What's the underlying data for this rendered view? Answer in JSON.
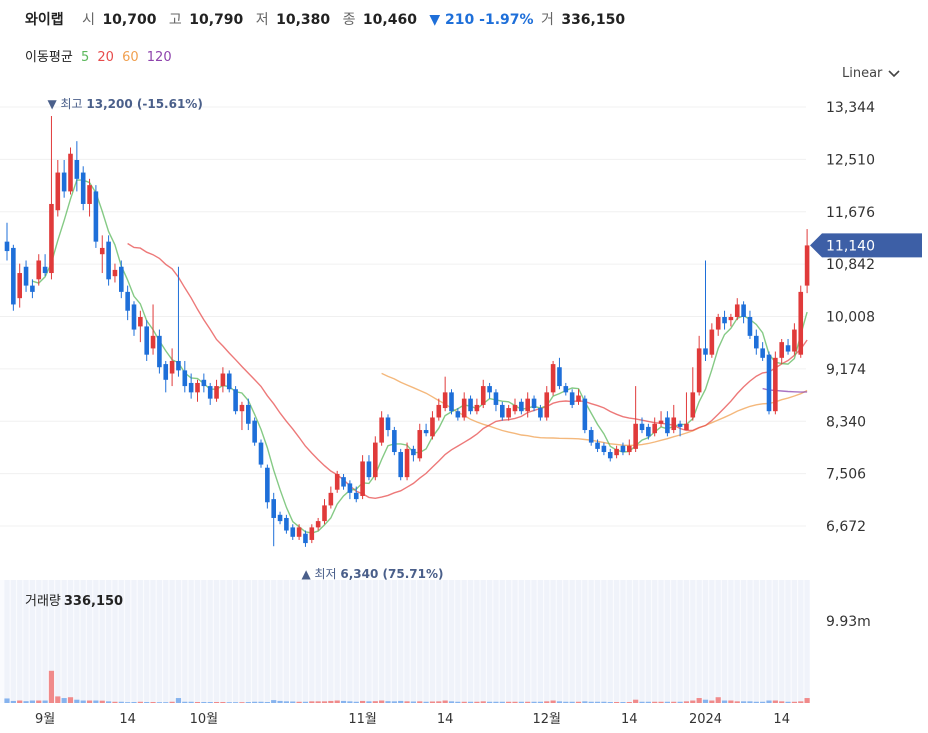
{
  "header": {
    "name": "와이랩",
    "open_label": "시",
    "open": "10,700",
    "high_label": "고",
    "high": "10,790",
    "low_label": "저",
    "low": "10,380",
    "close_label": "종",
    "close": "10,460",
    "change": "▼ 210 -1.97%",
    "volume_label": "거",
    "volume": "336,150"
  },
  "moving_average": {
    "label": "이동평균",
    "periods": [
      {
        "label": "5",
        "color": "#5cb85c"
      },
      {
        "label": "20",
        "color": "#e74c4c"
      },
      {
        "label": "60",
        "color": "#f0a050"
      },
      {
        "label": "120",
        "color": "#8e44ad"
      }
    ]
  },
  "scale_selector": {
    "value": "Linear",
    "icon": "chevron-down-icon"
  },
  "volume_panel": {
    "label": "거래량",
    "value": "336,150",
    "axis_label": "9.93m"
  },
  "colors": {
    "up": "#e03a3a",
    "down": "#1e6fd9",
    "current_price_tag": "#3d5fa6"
  },
  "chart_data": {
    "type": "candlestick",
    "y_ticks": [
      "13,344",
      "12,510",
      "11,676",
      "10,842",
      "10,008",
      "9,174",
      "8,340",
      "7,506",
      "6,672"
    ],
    "y_tick_values": [
      13344,
      12510,
      11676,
      10842,
      10008,
      9174,
      8340,
      7506,
      6672
    ],
    "x_ticks": [
      "9월",
      "14",
      "10월",
      "11월",
      "14",
      "12월",
      "14",
      "2024",
      "14"
    ],
    "x_tick_index": [
      6,
      19,
      31,
      56,
      69,
      85,
      98,
      110,
      122
    ],
    "current_price": "11,140",
    "current_price_value": 11140,
    "high_marker": {
      "arrow": "▼",
      "label": "최고",
      "value": "13,200 (-15.61%)",
      "index": 7,
      "price": 13200
    },
    "low_marker": {
      "arrow": "▲",
      "label": "최저",
      "value": "6,340 (75.71%)",
      "index": 47,
      "price": 6340
    },
    "candles": [
      [
        11200,
        11050,
        11500,
        10900
      ],
      [
        11100,
        10200,
        11150,
        10100
      ],
      [
        10300,
        10700,
        10850,
        10150
      ],
      [
        10800,
        10500,
        10900,
        10400
      ],
      [
        10500,
        10400,
        10600,
        10300
      ],
      [
        10600,
        10900,
        11000,
        10500
      ],
      [
        10800,
        10700,
        11000,
        10650
      ],
      [
        10700,
        11800,
        13200,
        10600
      ],
      [
        11700,
        12300,
        12500,
        11600
      ],
      [
        12300,
        12000,
        12500,
        11900
      ],
      [
        12000,
        12600,
        12700,
        11950
      ],
      [
        12500,
        12200,
        12800,
        12000
      ],
      [
        12300,
        11800,
        12400,
        11700
      ],
      [
        11800,
        12100,
        12200,
        11600
      ],
      [
        12000,
        11200,
        12100,
        11100
      ],
      [
        11000,
        11100,
        11300,
        10700
      ],
      [
        11200,
        10600,
        11300,
        10500
      ],
      [
        10650,
        10750,
        10850,
        10550
      ],
      [
        10800,
        10400,
        10900,
        10300
      ],
      [
        10400,
        10100,
        10500,
        9950
      ],
      [
        10200,
        9800,
        10250,
        9700
      ],
      [
        9850,
        10000,
        10100,
        9600
      ],
      [
        9850,
        9400,
        9950,
        9300
      ],
      [
        9500,
        9700,
        10200,
        9400
      ],
      [
        9700,
        9200,
        9800,
        9100
      ],
      [
        9250,
        9000,
        9300,
        8800
      ],
      [
        9100,
        9300,
        9500,
        8900
      ],
      [
        9300,
        9150,
        10800,
        9050
      ],
      [
        9150,
        8900,
        9300,
        8800
      ],
      [
        8950,
        8800,
        9100,
        8700
      ],
      [
        8800,
        8950,
        9000,
        8650
      ],
      [
        9000,
        8900,
        9100,
        8800
      ],
      [
        8900,
        8700,
        8950,
        8600
      ],
      [
        8700,
        8900,
        9000,
        8650
      ],
      [
        8900,
        9100,
        9200,
        8800
      ],
      [
        9100,
        8850,
        9150,
        8800
      ],
      [
        8850,
        8500,
        8900,
        8450
      ],
      [
        8500,
        8600,
        8650,
        8200
      ],
      [
        8600,
        8300,
        8700,
        8200
      ],
      [
        8350,
        8000,
        8400,
        7950
      ],
      [
        8000,
        7650,
        8050,
        7600
      ],
      [
        7600,
        7050,
        7650,
        6950
      ],
      [
        7100,
        6800,
        7200,
        6350
      ],
      [
        6850,
        6750,
        6900,
        6700
      ],
      [
        6800,
        6600,
        6850,
        6550
      ],
      [
        6650,
        6500,
        6700,
        6450
      ],
      [
        6500,
        6650,
        6700,
        6450
      ],
      [
        6550,
        6400,
        6600,
        6340
      ],
      [
        6450,
        6650,
        6700,
        6400
      ],
      [
        6650,
        6750,
        6800,
        6600
      ],
      [
        6750,
        7000,
        7100,
        6700
      ],
      [
        7000,
        7200,
        7300,
        6950
      ],
      [
        7250,
        7500,
        7550,
        7200
      ],
      [
        7450,
        7300,
        7500,
        7250
      ],
      [
        7350,
        7200,
        7400,
        7100
      ],
      [
        7200,
        7100,
        7300,
        7050
      ],
      [
        7150,
        7700,
        7800,
        7100
      ],
      [
        7700,
        7450,
        7800,
        7400
      ],
      [
        7450,
        8000,
        8100,
        7400
      ],
      [
        8000,
        8400,
        8500,
        7950
      ],
      [
        8400,
        8200,
        8450,
        8100
      ],
      [
        8200,
        7850,
        8250,
        7800
      ],
      [
        7850,
        7450,
        7900,
        7400
      ],
      [
        7450,
        7900,
        8000,
        7400
      ],
      [
        7900,
        7800,
        7950,
        7700
      ],
      [
        7750,
        8200,
        8300,
        7700
      ],
      [
        8200,
        8150,
        8300,
        8100
      ],
      [
        8100,
        8400,
        8500,
        8050
      ],
      [
        8400,
        8600,
        8700,
        8350
      ],
      [
        8550,
        8800,
        9050,
        8500
      ],
      [
        8800,
        8500,
        8850,
        8450
      ],
      [
        8500,
        8400,
        8550,
        8350
      ],
      [
        8400,
        8700,
        8800,
        8350
      ],
      [
        8700,
        8500,
        8750,
        8450
      ],
      [
        8500,
        8600,
        8700,
        8450
      ],
      [
        8600,
        8900,
        9000,
        8550
      ],
      [
        8900,
        8800,
        8950,
        8700
      ],
      [
        8800,
        8600,
        8850,
        8500
      ],
      [
        8600,
        8400,
        8650,
        8350
      ],
      [
        8400,
        8550,
        8600,
        8350
      ],
      [
        8500,
        8600,
        8700,
        8450
      ],
      [
        8650,
        8500,
        8700,
        8450
      ],
      [
        8500,
        8700,
        8800,
        8400
      ],
      [
        8700,
        8550,
        8750,
        8500
      ],
      [
        8550,
        8400,
        8600,
        8350
      ],
      [
        8400,
        8800,
        8900,
        8350
      ],
      [
        8800,
        9250,
        9300,
        8750
      ],
      [
        9200,
        8900,
        9350,
        8850
      ],
      [
        8900,
        8800,
        8950,
        8750
      ],
      [
        8800,
        8600,
        8850,
        8550
      ],
      [
        8650,
        8750,
        8850,
        8600
      ],
      [
        8700,
        8200,
        8750,
        8150
      ],
      [
        8200,
        8000,
        8250,
        7950
      ],
      [
        8000,
        7900,
        8050,
        7850
      ],
      [
        7950,
        7850,
        8000,
        7800
      ],
      [
        7850,
        7750,
        7900,
        7700
      ],
      [
        7800,
        7900,
        7950,
        7750
      ],
      [
        7950,
        7850,
        8000,
        7800
      ],
      [
        7850,
        7950,
        8050,
        7800
      ],
      [
        7900,
        8300,
        8900,
        7850
      ],
      [
        8300,
        8200,
        8400,
        8150
      ],
      [
        8250,
        8100,
        8300,
        8050
      ],
      [
        8150,
        8300,
        8400,
        8100
      ],
      [
        8300,
        8350,
        8500,
        8250
      ],
      [
        8400,
        8150,
        8500,
        8100
      ],
      [
        8200,
        8400,
        8600,
        8150
      ],
      [
        8300,
        8250,
        8350,
        8100
      ],
      [
        8200,
        8300,
        8800,
        8200
      ],
      [
        8400,
        8800,
        9200,
        8350
      ],
      [
        8800,
        9500,
        9700,
        8750
      ],
      [
        9500,
        9400,
        10900,
        9300
      ],
      [
        9400,
        9800,
        9900,
        9350
      ],
      [
        9800,
        10000,
        10050,
        9700
      ],
      [
        10000,
        9900,
        10100,
        9800
      ],
      [
        9950,
        10000,
        10050,
        9850
      ],
      [
        10000,
        10200,
        10300,
        9950
      ],
      [
        10200,
        10000,
        10250,
        9900
      ],
      [
        10000,
        9700,
        10100,
        9650
      ],
      [
        9700,
        9500,
        9800,
        9400
      ],
      [
        9500,
        9350,
        9600,
        9300
      ],
      [
        9400,
        8500,
        9450,
        8450
      ],
      [
        8500,
        9350,
        9450,
        8450
      ],
      [
        9350,
        9600,
        9650,
        9250
      ],
      [
        9550,
        9450,
        9650,
        9400
      ],
      [
        9450,
        9800,
        9900,
        9400
      ],
      [
        9400,
        10400,
        10500,
        9350
      ],
      [
        10500,
        11140,
        11400,
        10380
      ]
    ],
    "volumes": [
      0.55,
      0.25,
      0.3,
      0.22,
      0.3,
      0.3,
      0.3,
      3.9,
      0.8,
      0.6,
      0.7,
      0.4,
      0.3,
      0.3,
      0.3,
      0.28,
      0.2,
      0.15,
      0.15,
      0.1,
      0.12,
      0.15,
      0.12,
      0.12,
      0.1,
      0.1,
      0.15,
      0.6,
      0.15,
      0.15,
      0.12,
      0.12,
      0.12,
      0.12,
      0.12,
      0.1,
      0.1,
      0.1,
      0.12,
      0.15,
      0.15,
      0.12,
      0.35,
      0.25,
      0.2,
      0.18,
      0.15,
      0.15,
      0.2,
      0.2,
      0.2,
      0.25,
      0.3,
      0.25,
      0.2,
      0.15,
      0.25,
      0.2,
      0.22,
      0.3,
      0.22,
      0.2,
      0.25,
      0.2,
      0.18,
      0.2,
      0.15,
      0.18,
      0.2,
      0.3,
      0.2,
      0.15,
      0.15,
      0.15,
      0.15,
      0.2,
      0.15,
      0.15,
      0.15,
      0.15,
      0.15,
      0.15,
      0.15,
      0.15,
      0.15,
      0.2,
      0.3,
      0.2,
      0.15,
      0.15,
      0.15,
      0.2,
      0.15,
      0.15,
      0.15,
      0.12,
      0.12,
      0.12,
      0.12,
      0.4,
      0.15,
      0.15,
      0.15,
      0.15,
      0.15,
      0.15,
      0.15,
      0.2,
      0.3,
      0.6,
      0.4,
      0.3,
      0.7,
      0.3,
      0.3,
      0.2,
      0.2,
      0.2,
      0.15,
      0.15,
      0.3,
      0.3,
      0.2,
      0.15,
      0.15,
      0.2,
      0.6
    ]
  }
}
